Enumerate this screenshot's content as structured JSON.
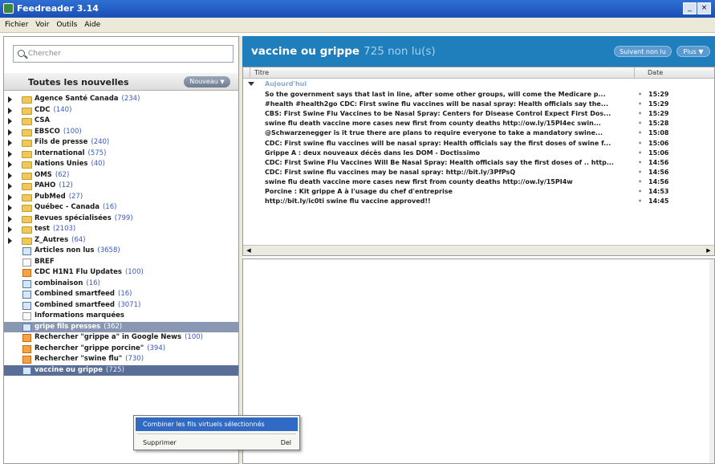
{
  "window": {
    "title": "Feedreader 3.14",
    "close_label": "×"
  },
  "menu": [
    "Fichier",
    "Voir",
    "Outils",
    "Aide"
  ],
  "search": {
    "placeholder": "Chercher"
  },
  "feeds_header": {
    "title": "Toutes les nouvelles",
    "button_label": "Nouveau"
  },
  "feeds": [
    {
      "label": "Agence Santé Canada",
      "count": "(234)",
      "type": "folder",
      "expandable": true
    },
    {
      "label": "CDC",
      "count": "(140)",
      "type": "folder",
      "expandable": true
    },
    {
      "label": "CSA",
      "count": "",
      "type": "folder",
      "expandable": true
    },
    {
      "label": "EBSCO",
      "count": "(100)",
      "type": "folder",
      "expandable": true
    },
    {
      "label": "Fils de presse",
      "count": "(240)",
      "type": "folder",
      "expandable": true
    },
    {
      "label": "International",
      "count": "(575)",
      "type": "folder",
      "expandable": true
    },
    {
      "label": "Nations Unies",
      "count": "(40)",
      "type": "folder",
      "expandable": true
    },
    {
      "label": "OMS",
      "count": "(62)",
      "type": "folder",
      "expandable": true
    },
    {
      "label": "PAHO",
      "count": "(12)",
      "type": "folder",
      "expandable": true
    },
    {
      "label": "PubMed",
      "count": "(27)",
      "type": "folder",
      "expandable": true
    },
    {
      "label": "Québec - Canada",
      "count": "(16)",
      "type": "folder",
      "expandable": true
    },
    {
      "label": "Revues spécialisées",
      "count": "(799)",
      "type": "folder",
      "expandable": true
    },
    {
      "label": "test",
      "count": "(2103)",
      "type": "folder",
      "expandable": true
    },
    {
      "label": "Z_Autres",
      "count": "(64)",
      "type": "folder",
      "expandable": true
    },
    {
      "label": "Articles non lus",
      "count": "(3658)",
      "type": "virtual",
      "expandable": false
    },
    {
      "label": "BREF",
      "count": "",
      "type": "doc",
      "expandable": false
    },
    {
      "label": "CDC H1N1 Flu Updates",
      "count": "(100)",
      "type": "rss",
      "expandable": false
    },
    {
      "label": "combinaison",
      "count": "(16)",
      "type": "virtual",
      "expandable": false
    },
    {
      "label": "Combined smartfeed",
      "count": "(16)",
      "type": "virtual",
      "expandable": false
    },
    {
      "label": "Combined smartfeed",
      "count": "(3071)",
      "type": "virtual",
      "expandable": false
    },
    {
      "label": "Informations marquées",
      "count": "",
      "type": "doc",
      "expandable": false
    },
    {
      "label": "gripe fils presses",
      "count": "(362)",
      "type": "virtual",
      "expandable": false,
      "selected": "light"
    },
    {
      "label": "Rechercher \"grippe a\" in Google News",
      "count": "(100)",
      "type": "rss",
      "expandable": false
    },
    {
      "label": "Rechercher \"grippe porcine\"",
      "count": "(394)",
      "type": "rss",
      "expandable": false
    },
    {
      "label": "Rechercher \"swine flu\"",
      "count": "(730)",
      "type": "rss",
      "expandable": false
    },
    {
      "label": "vaccine ou grippe",
      "count": "(725)",
      "type": "virtual",
      "expandable": false,
      "selected": "dark"
    }
  ],
  "right_header": {
    "title": "vaccine ou grippe",
    "count": "725 non lu(s)",
    "next_unread": "Suivant non lu",
    "more": "Plus"
  },
  "columns": {
    "title": "Titre",
    "date": "Date"
  },
  "group": {
    "label": "Aujourd'hui"
  },
  "articles": [
    {
      "title": "So the government says that last in line, after some other groups, will come the Medicare p...",
      "time": "15:29"
    },
    {
      "title": "#health #health2go CDC: First swine flu vaccines will be nasal spray: Health officials say the...",
      "time": "15:29"
    },
    {
      "title": "CBS: First Swine Flu Vaccines to be Nasal Spray: Centers for Disease Control Expect First Dos...",
      "time": "15:29"
    },
    {
      "title": "swine flu death vaccine more cases new first from county deaths http://ow.ly/15PI4ec swin...",
      "time": "15:28"
    },
    {
      "title": "@Schwarzenegger is it true there are plans to require everyone to take a mandatory swine...",
      "time": "15:08"
    },
    {
      "title": "CDC: First swine flu vaccines will be nasal spray: Health officials say the first doses of swine f...",
      "time": "15:06"
    },
    {
      "title": "Grippe A : deux nouveaux décès dans les DOM - Doctissimo",
      "time": "15:06"
    },
    {
      "title": "CDC: First Swine Flu Vaccines Will Be Nasal Spray: Health officials say the first doses of .. http...",
      "time": "14:56"
    },
    {
      "title": "CDC: First swine flu vaccines may be nasal spray: http://bit.ly/3PfPsQ",
      "time": "14:56"
    },
    {
      "title": "swine flu death vaccine more cases new first from county deaths http://ow.ly/15PI4w",
      "time": "14:56"
    },
    {
      "title": "Porcine : Kit grippe A à l'usage du chef d'entreprise",
      "time": "14:53"
    },
    {
      "title": "http://bit.ly/ic0ti swine flu vaccine approved!!",
      "time": "14:45"
    }
  ],
  "context_menu": {
    "item1": "Combiner les fils virtuels sélectionnés",
    "item2": "Supprimer",
    "item2_key": "Del"
  }
}
